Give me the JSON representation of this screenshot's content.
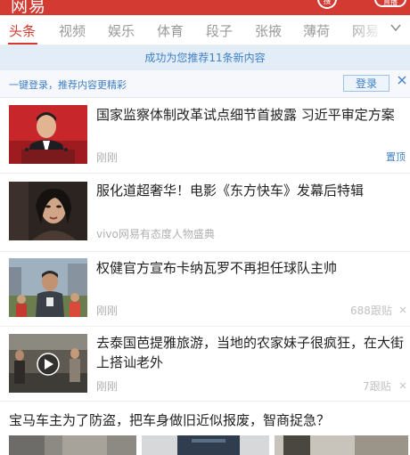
{
  "header": {
    "logo": "网易",
    "search_label": "搜",
    "live_label": "直播"
  },
  "tabs": [
    "头条",
    "视频",
    "娱乐",
    "体育",
    "段子",
    "张掖",
    "薄荷",
    "网易"
  ],
  "refresh_banner": "成功为您推荐11条新内容",
  "login_bar": {
    "hint": "一键登录，推荐内容更精彩",
    "button": "登录"
  },
  "news": [
    {
      "title": "国家监察体制改革试点细节首披露 习近平审定方案",
      "source": "刚刚",
      "badge": "置顶"
    },
    {
      "title": "服化道超奢华！电影《东方快车》发幕后特辑",
      "source": "vivo网易有态度人物盛典"
    },
    {
      "title": "权健官方宣布卡纳瓦罗不再担任球队主帅",
      "source": "刚刚",
      "comments": "688跟贴"
    },
    {
      "title": "去泰国芭提雅旅游，当地的农家妹子很疯狂，在大街上搭讪老外",
      "source": "刚刚",
      "comments": "7跟贴"
    },
    {
      "title": "宝马车主为了防盗，把车身做旧近似报废，智商捉急？"
    }
  ],
  "icons": {
    "chevron": "chevron-down-icon",
    "close": "close-icon",
    "play": "play-icon",
    "dismiss": "dismiss-icon"
  },
  "colors": {
    "brand": "#d33a31",
    "link": "#3f7fc6"
  }
}
